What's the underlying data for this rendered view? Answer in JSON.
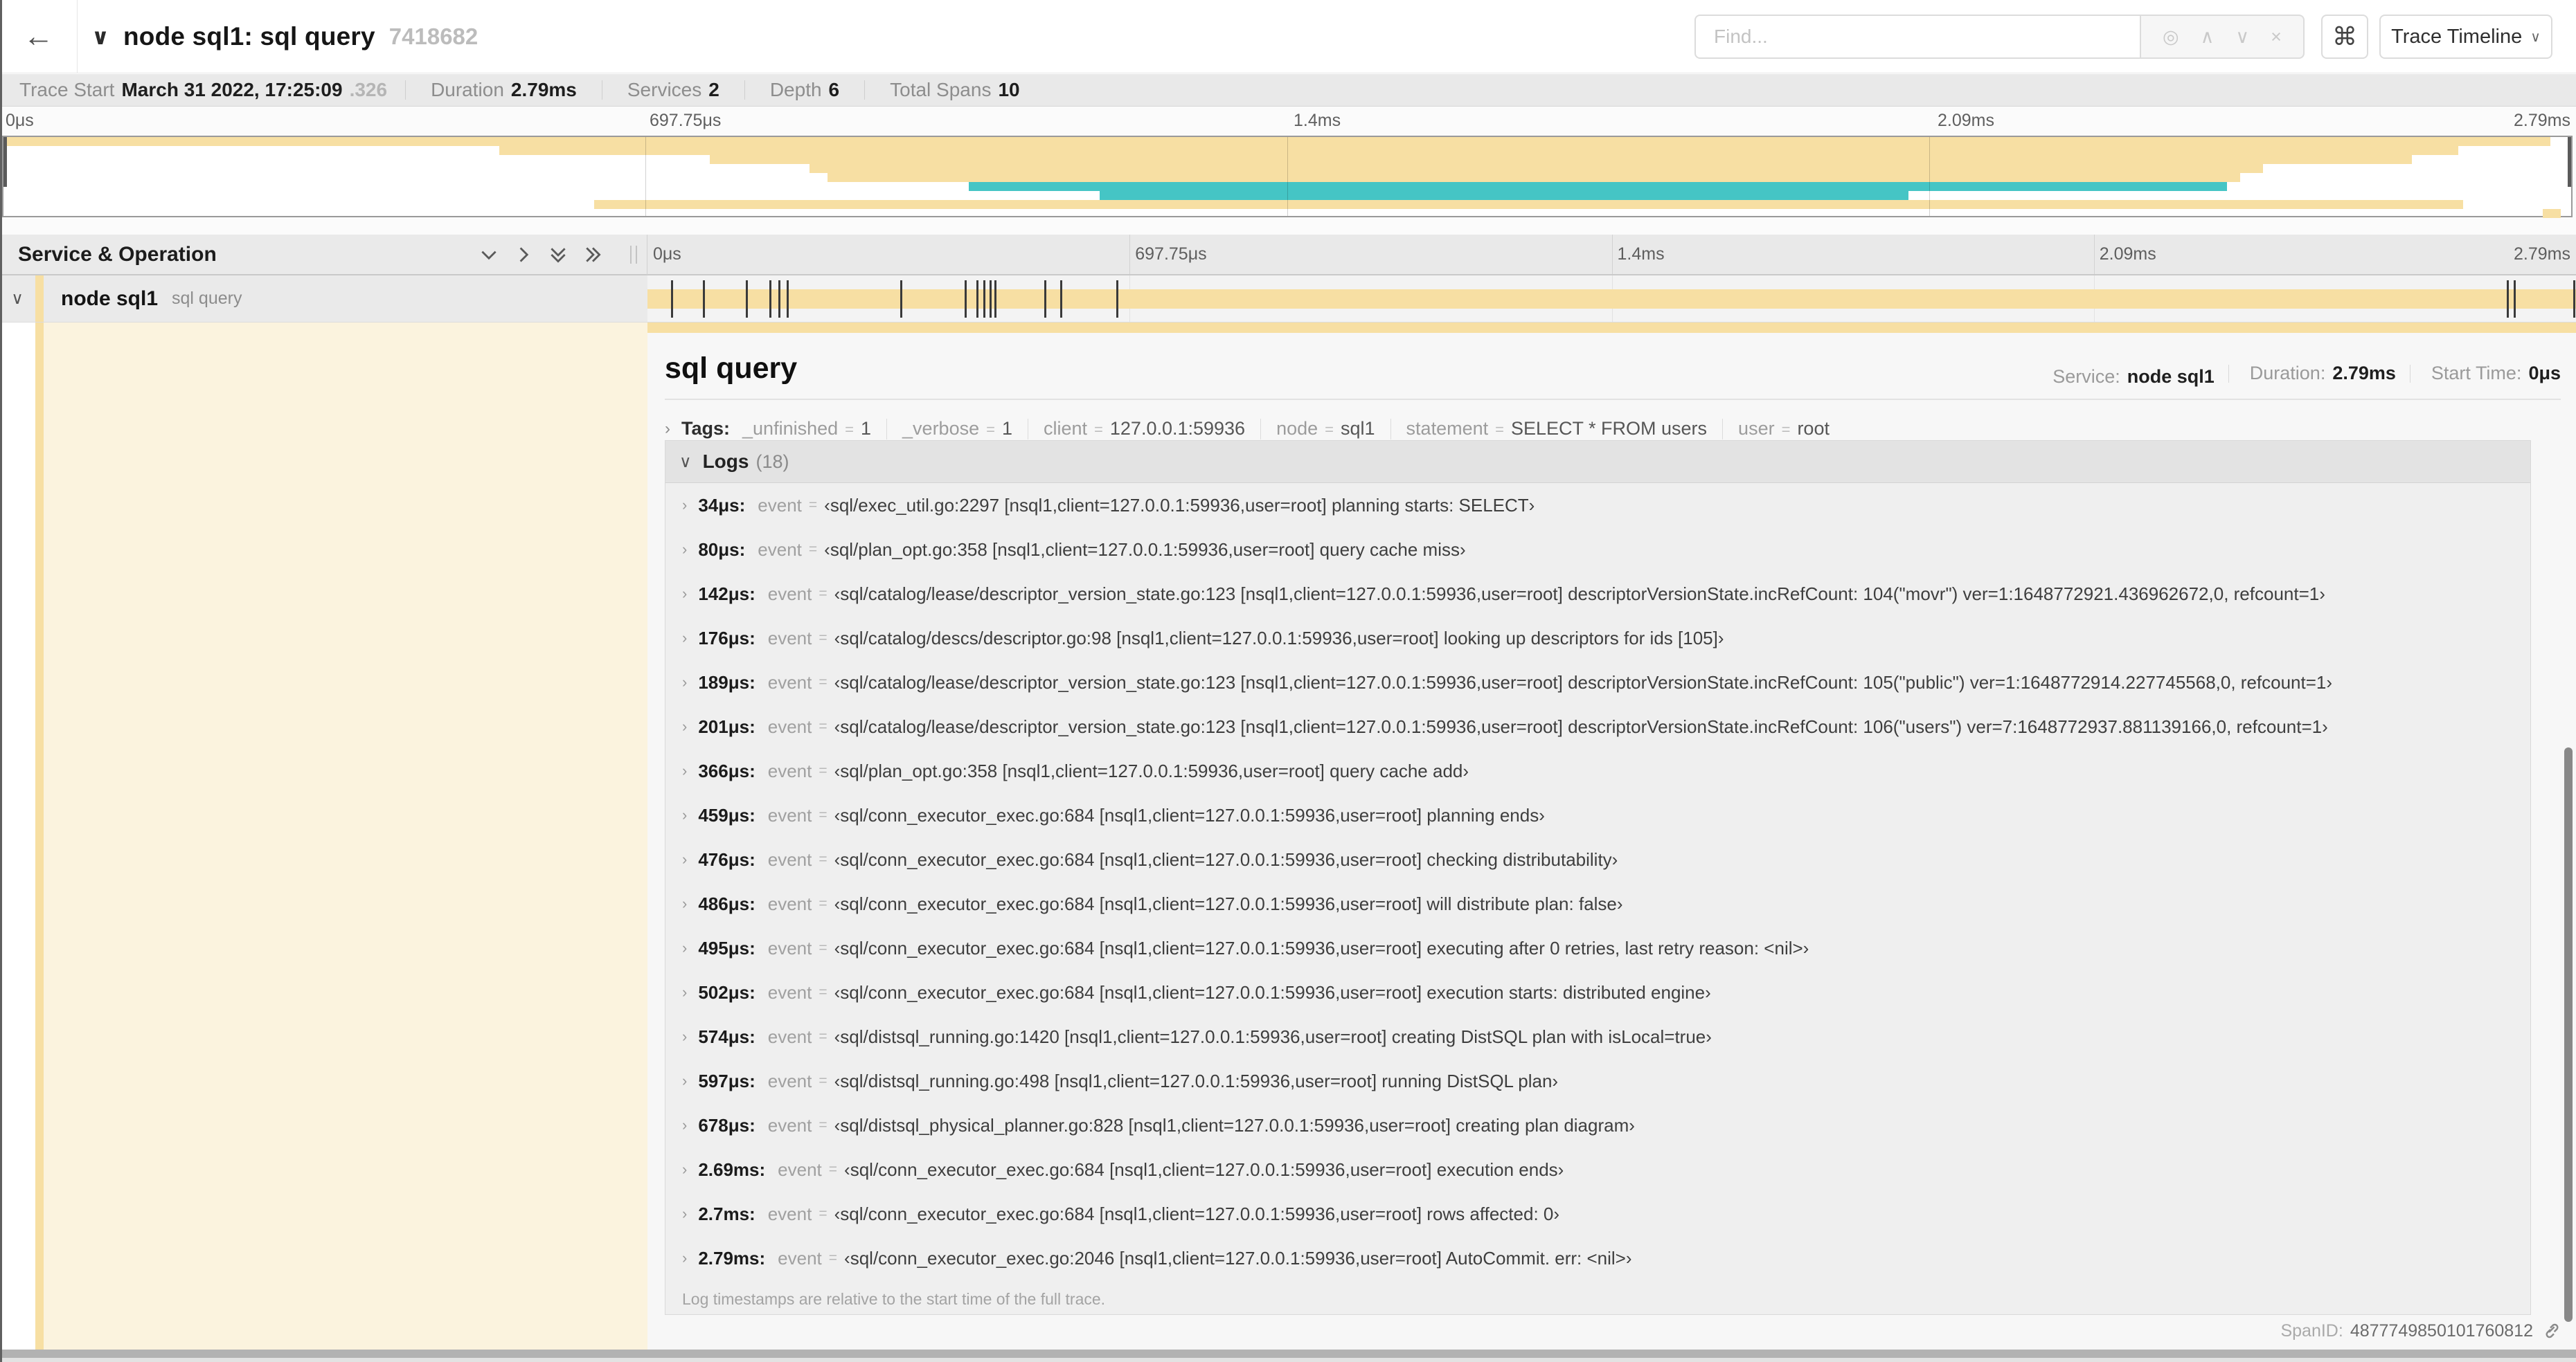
{
  "colors": {
    "span_tan": "#f7dfa3",
    "span_teal": "#45c5c5",
    "selected_row_bg": "#eaeaea",
    "accent_cream": "#fbf3de"
  },
  "icons": {
    "back": "←",
    "title_collapse": "∨",
    "locate": "◎",
    "prev": "∧",
    "next": "∨",
    "clear": "×",
    "keyboard_shortcut": "⌘",
    "view_caret": "∨",
    "row_expander": "∨",
    "section_collapsed": "›",
    "section_expanded": "∨"
  },
  "header": {
    "title": "node sql1: sql query",
    "trace_id": "7418682",
    "find_placeholder": "Find...",
    "view_button": "Trace Timeline"
  },
  "summary": {
    "items": [
      {
        "label": "Trace Start",
        "value": "March 31 2022, 17:25:09",
        "suffix": ".326"
      },
      {
        "label": "Duration",
        "value": "2.79ms"
      },
      {
        "label": "Services",
        "value": "2"
      },
      {
        "label": "Depth",
        "value": "6"
      },
      {
        "label": "Total Spans",
        "value": "10"
      }
    ]
  },
  "minimap": {
    "ticks": [
      {
        "label": "0μs",
        "pos": 0,
        "align": "left"
      },
      {
        "label": "697.75μs",
        "pos": 25,
        "align": "left"
      },
      {
        "label": "1.4ms",
        "pos": 50,
        "align": "left"
      },
      {
        "label": "2.09ms",
        "pos": 75,
        "align": "left"
      },
      {
        "label": "2.79ms",
        "pos": 100,
        "align": "right"
      }
    ],
    "gridlines": [
      25,
      50,
      75
    ],
    "bars": [
      {
        "row": 0,
        "left": 0,
        "width": 99.2,
        "color": "#f7dfa3"
      },
      {
        "row": 1,
        "left": 19.3,
        "width": 76.3,
        "color": "#f7dfa3"
      },
      {
        "row": 2,
        "left": 27.5,
        "width": 66.3,
        "color": "#f7dfa3"
      },
      {
        "row": 3,
        "left": 31.4,
        "width": 56.6,
        "color": "#f7dfa3"
      },
      {
        "row": 4,
        "left": 32.1,
        "width": 55.0,
        "color": "#f7dfa3"
      },
      {
        "row": 5,
        "left": 37.6,
        "width": 49.0,
        "color": "#45c5c5"
      },
      {
        "row": 6,
        "left": 42.7,
        "width": 31.5,
        "color": "#45c5c5"
      },
      {
        "row": 7,
        "left": 23.0,
        "width": 72.8,
        "color": "#f7dfa3"
      },
      {
        "row": 8,
        "left": 98.9,
        "width": 0.7,
        "color": "#f7dfa3"
      }
    ]
  },
  "grid": {
    "left_header": "Service & Operation",
    "ticks": [
      {
        "label": "0μs",
        "pos": 0,
        "align": "left"
      },
      {
        "label": "697.75μs",
        "pos": 25,
        "align": "left"
      },
      {
        "label": "1.4ms",
        "pos": 50,
        "align": "left"
      },
      {
        "label": "2.09ms",
        "pos": 75,
        "align": "left"
      },
      {
        "label": "2.79ms",
        "pos": 100,
        "align": "right"
      }
    ],
    "gridlines": [
      25,
      50,
      75
    ]
  },
  "span_row": {
    "service": "node sql1",
    "operation": "sql query",
    "bar": {
      "left": 0,
      "width": 100
    },
    "markers": [
      1.22,
      2.87,
      5.09,
      6.31,
      6.77,
      7.2,
      13.12,
      16.45,
      17.06,
      17.42,
      17.74,
      17.99,
      20.57,
      21.4,
      24.3,
      96.42,
      96.77,
      99.85
    ]
  },
  "detail": {
    "title": "sql query",
    "stats": [
      {
        "label": "Service:",
        "value": "node sql1"
      },
      {
        "label": "Duration:",
        "value": "2.79ms"
      },
      {
        "label": "Start Time:",
        "value": "0μs"
      }
    ],
    "tags_label": "Tags:",
    "tags": [
      {
        "key": "_unfinished",
        "value": "1"
      },
      {
        "key": "_verbose",
        "value": "1"
      },
      {
        "key": "client",
        "value": "127.0.0.1:59936"
      },
      {
        "key": "node",
        "value": "sql1"
      },
      {
        "key": "statement",
        "value": "SELECT * FROM users"
      },
      {
        "key": "user",
        "value": "root"
      }
    ],
    "logs_label": "Logs",
    "logs_count": "(18)",
    "logs": [
      {
        "time": "34μs:",
        "key": "event",
        "value": "‹sql/exec_util.go:2297 [nsql1,client=127.0.0.1:59936,user=root] planning starts: SELECT›"
      },
      {
        "time": "80μs:",
        "key": "event",
        "value": "‹sql/plan_opt.go:358 [nsql1,client=127.0.0.1:59936,user=root] query cache miss›"
      },
      {
        "time": "142μs:",
        "key": "event",
        "value": "‹sql/catalog/lease/descriptor_version_state.go:123 [nsql1,client=127.0.0.1:59936,user=root] descriptorVersionState.incRefCount: 104(\"movr\") ver=1:1648772921.436962672,0, refcount=1›"
      },
      {
        "time": "176μs:",
        "key": "event",
        "value": "‹sql/catalog/descs/descriptor.go:98 [nsql1,client=127.0.0.1:59936,user=root] looking up descriptors for ids [105]›"
      },
      {
        "time": "189μs:",
        "key": "event",
        "value": "‹sql/catalog/lease/descriptor_version_state.go:123 [nsql1,client=127.0.0.1:59936,user=root] descriptorVersionState.incRefCount: 105(\"public\") ver=1:1648772914.227745568,0, refcount=1›"
      },
      {
        "time": "201μs:",
        "key": "event",
        "value": "‹sql/catalog/lease/descriptor_version_state.go:123 [nsql1,client=127.0.0.1:59936,user=root] descriptorVersionState.incRefCount: 106(\"users\") ver=7:1648772937.881139166,0, refcount=1›"
      },
      {
        "time": "366μs:",
        "key": "event",
        "value": "‹sql/plan_opt.go:358 [nsql1,client=127.0.0.1:59936,user=root] query cache add›"
      },
      {
        "time": "459μs:",
        "key": "event",
        "value": "‹sql/conn_executor_exec.go:684 [nsql1,client=127.0.0.1:59936,user=root] planning ends›"
      },
      {
        "time": "476μs:",
        "key": "event",
        "value": "‹sql/conn_executor_exec.go:684 [nsql1,client=127.0.0.1:59936,user=root] checking distributability›"
      },
      {
        "time": "486μs:",
        "key": "event",
        "value": "‹sql/conn_executor_exec.go:684 [nsql1,client=127.0.0.1:59936,user=root] will distribute plan: false›"
      },
      {
        "time": "495μs:",
        "key": "event",
        "value": "‹sql/conn_executor_exec.go:684 [nsql1,client=127.0.0.1:59936,user=root] executing after 0 retries, last retry reason: <nil>›"
      },
      {
        "time": "502μs:",
        "key": "event",
        "value": "‹sql/conn_executor_exec.go:684 [nsql1,client=127.0.0.1:59936,user=root] execution starts: distributed engine›"
      },
      {
        "time": "574μs:",
        "key": "event",
        "value": "‹sql/distsql_running.go:1420 [nsql1,client=127.0.0.1:59936,user=root] creating DistSQL plan with isLocal=true›"
      },
      {
        "time": "597μs:",
        "key": "event",
        "value": "‹sql/distsql_running.go:498 [nsql1,client=127.0.0.1:59936,user=root] running DistSQL plan›"
      },
      {
        "time": "678μs:",
        "key": "event",
        "value": "‹sql/distsql_physical_planner.go:828 [nsql1,client=127.0.0.1:59936,user=root] creating plan diagram›"
      },
      {
        "time": "2.69ms:",
        "key": "event",
        "value": "‹sql/conn_executor_exec.go:684 [nsql1,client=127.0.0.1:59936,user=root] execution ends›"
      },
      {
        "time": "2.7ms:",
        "key": "event",
        "value": "‹sql/conn_executor_exec.go:684 [nsql1,client=127.0.0.1:59936,user=root] rows affected: 0›"
      },
      {
        "time": "2.79ms:",
        "key": "event",
        "value": "‹sql/conn_executor_exec.go:2046 [nsql1,client=127.0.0.1:59936,user=root] AutoCommit. err: <nil>›"
      }
    ],
    "note": "Log timestamps are relative to the start time of the full trace.",
    "span_id_label": "SpanID:",
    "span_id": "4877749850101760812"
  }
}
